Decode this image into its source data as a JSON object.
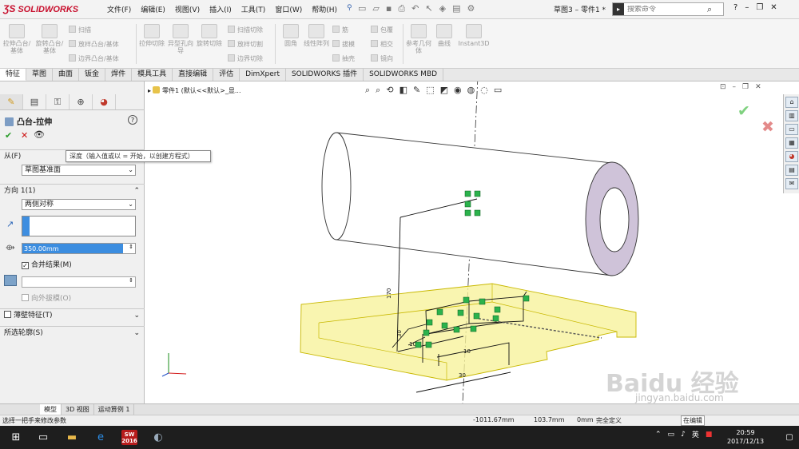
{
  "app": {
    "brand": "SOLIDWORKS",
    "doc_title": "草图3 – 零件1 *"
  },
  "menu": [
    "文件(F)",
    "编辑(E)",
    "视图(V)",
    "插入(I)",
    "工具(T)",
    "窗口(W)",
    "帮助(H)"
  ],
  "search": {
    "placeholder": "搜索命令"
  },
  "ribbon": {
    "extrude_boss": "拉伸凸台/基体",
    "revolve_boss": "旋转凸台/基体",
    "sweep": "扫描",
    "loft": "放样凸台/基体",
    "boundary": "边界凸台/基体",
    "extrude_cut": "拉伸切除",
    "hole_wizard": "异型孔向导",
    "revolve_cut": "旋转切除",
    "swept_cut": "扫描切除",
    "lofted_cut": "放样切割",
    "boundary_cut": "边界切除",
    "fillet": "圆角",
    "linear_pattern": "线性阵列",
    "rib": "筋",
    "draft": "拔模",
    "shell": "抽壳",
    "wrap": "包覆",
    "intersect": "相交",
    "mirror": "镜向",
    "ref_geometry": "参考几何体",
    "curves": "曲线",
    "instant3d": "Instant3D"
  },
  "tabs": [
    "特征",
    "草图",
    "曲面",
    "钣金",
    "焊件",
    "模具工具",
    "直接编辑",
    "评估",
    "DimXpert",
    "SOLIDWORKS 插件",
    "SOLIDWORKS MBD"
  ],
  "property_manager": {
    "title": "凸台-拉伸",
    "from_label": "从(F)",
    "from_value": "草图基准面",
    "direction_label": "方向 1(1)",
    "end_condition": "两侧对称",
    "tooltip": "深度（输入值或以 = 开始，以创建方程式）",
    "depth_value": "350.00mm",
    "merge_result": "合并结果(M)",
    "draft_outward": "向外拔模(O)",
    "thin_feature": "薄壁特征(T)",
    "selected_contours": "所选轮廓(S)"
  },
  "feature_tree": {
    "breadcrumb": "零件1 (默认<<默认>_显..."
  },
  "sketch": {
    "dim_small": "10",
    "dim_170": "170",
    "dim_30": "30",
    "dim_tick": "10",
    "dim_long": "30"
  },
  "bottom_tabs": [
    "模型",
    "3D 视图",
    "运动算例 1"
  ],
  "status": {
    "message": "选择一把手来修改参数",
    "x": "-1011.67mm",
    "y": "103.7mm",
    "z": "0mm",
    "state": "完全定义",
    "units": "在编辑"
  },
  "taskbar": {
    "ime": "英",
    "time": "20:59",
    "date": "2017/12/13"
  },
  "watermark": {
    "main": "Baidu 经验",
    "sub": "jingyan.baidu.com"
  },
  "colors": {
    "accent": "#c8102e",
    "selection": "#3b8de0",
    "tube_end": "#cfc3d9",
    "plate": "#f7f29a"
  }
}
